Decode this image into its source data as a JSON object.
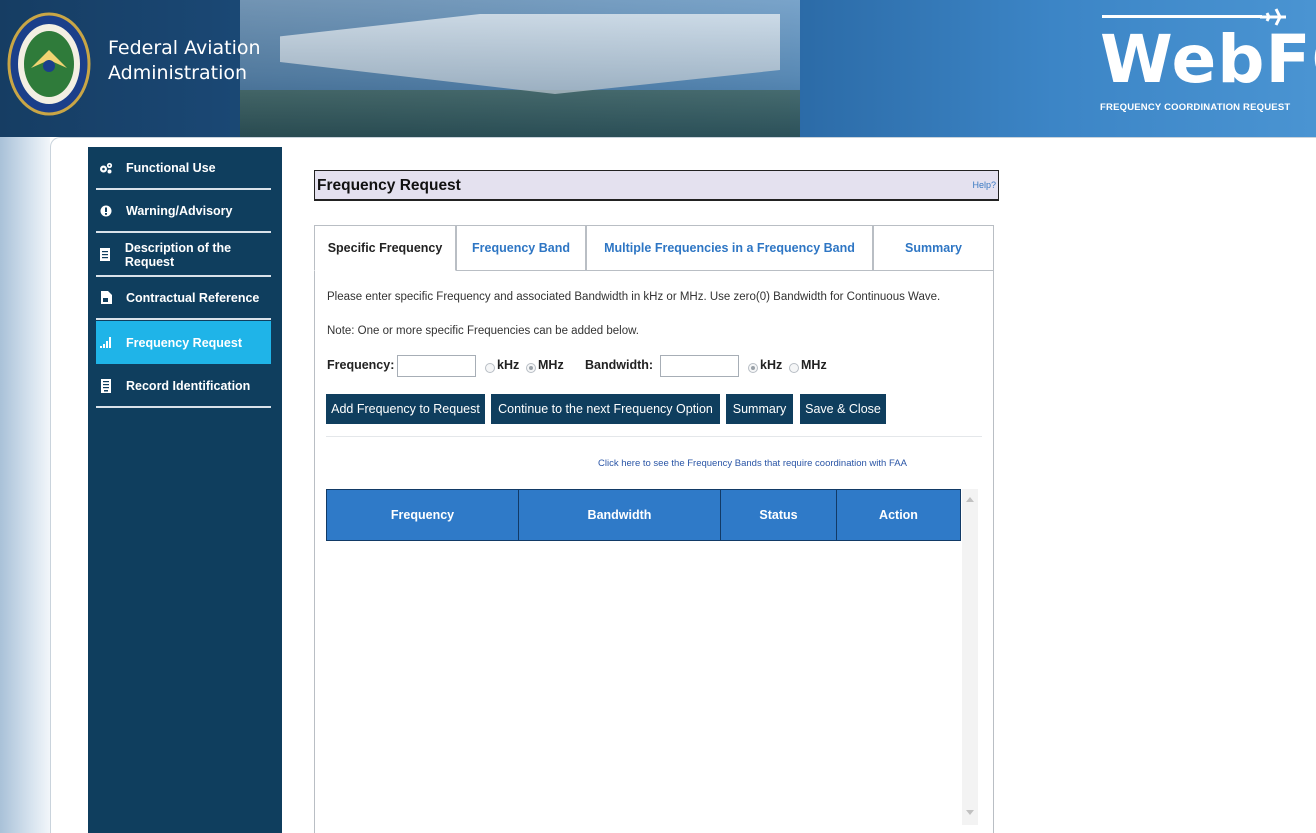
{
  "header": {
    "agency_line1": "Federal Aviation",
    "agency_line2": "Administration",
    "logo_text": "WebFCR",
    "logo_subtitle": "FREQUENCY COORDINATION REQUEST",
    "seal_icon": "faa-seal-icon"
  },
  "sidebar": {
    "items": [
      {
        "label": "Functional Use",
        "icon": "cogs-icon",
        "active": false
      },
      {
        "label": "Warning/Advisory",
        "icon": "exclamation-icon",
        "active": false
      },
      {
        "label": "Description of the Request",
        "icon": "document-icon",
        "active": false
      },
      {
        "label": "Contractual Reference",
        "icon": "file-icon",
        "active": false
      },
      {
        "label": "Frequency Request",
        "icon": "signal-bars-icon",
        "active": true
      },
      {
        "label": "Record Identification",
        "icon": "record-icon",
        "active": false
      }
    ],
    "active_color": "#1fb4e8",
    "background_color": "#0f3e5e"
  },
  "main": {
    "title": "Frequency Request",
    "help_label": "Help?",
    "tabs": [
      {
        "label": "Specific Frequency",
        "active": true
      },
      {
        "label": "Frequency Band",
        "active": false
      },
      {
        "label": "Multiple Frequencies in a Frequency Band",
        "active": false
      },
      {
        "label": "Summary",
        "active": false
      }
    ],
    "instruction": "Please enter specific Frequency and associated Bandwidth in kHz or MHz. Use zero(0) Bandwidth for Continuous Wave.",
    "note": "Note: One or more specific Frequencies can be added below.",
    "form": {
      "frequency_label": "Frequency:",
      "frequency_value": "",
      "frequency_unit_khz": "kHz",
      "frequency_unit_mhz": "MHz",
      "frequency_unit_selected": "MHz",
      "bandwidth_label": "Bandwidth:",
      "bandwidth_value": "",
      "bandwidth_unit_khz": "kHz",
      "bandwidth_unit_mhz": "MHz",
      "bandwidth_unit_selected": "kHz"
    },
    "buttons": {
      "add": "Add Frequency to Request",
      "continue": "Continue to the next Frequency Option",
      "summary": "Summary",
      "save_close": "Save & Close"
    },
    "bands_link": "Click here to see the Frequency Bands that require coordination with FAA",
    "grid": {
      "columns": [
        "Frequency",
        "Bandwidth",
        "Status",
        "Action"
      ],
      "rows": []
    },
    "button_color": "#0f3e5e",
    "grid_header_color": "#2f7ac8"
  }
}
